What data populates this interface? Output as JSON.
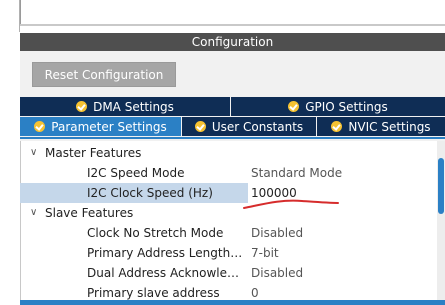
{
  "config_title": "Configuration",
  "reset_button": "Reset Configuration",
  "tabs_row1": [
    {
      "label": "DMA Settings"
    },
    {
      "label": "GPIO Settings"
    }
  ],
  "tabs_row2": [
    {
      "label": "Parameter Settings",
      "active": true
    },
    {
      "label": "User Constants"
    },
    {
      "label": "NVIC Settings"
    }
  ],
  "tree": {
    "master": {
      "label": "Master Features",
      "items": [
        {
          "name": "I2C Speed Mode",
          "value": "Standard Mode"
        },
        {
          "name": "I2C Clock Speed (Hz)",
          "value": "100000",
          "selected": true
        }
      ]
    },
    "slave": {
      "label": "Slave Features",
      "items": [
        {
          "name": "Clock No Stretch Mode",
          "value": "Disabled"
        },
        {
          "name": "Primary Address Length ...",
          "value": "7-bit"
        },
        {
          "name": "Dual Address Acknowled...",
          "value": "Disabled"
        },
        {
          "name": "Primary slave address",
          "value": "0"
        }
      ]
    }
  },
  "colors": {
    "tab_dark": "#0f2d55",
    "tab_active": "#2b80c5",
    "check_icon": "#f6c232",
    "annotation_stroke": "#d62c2c"
  }
}
